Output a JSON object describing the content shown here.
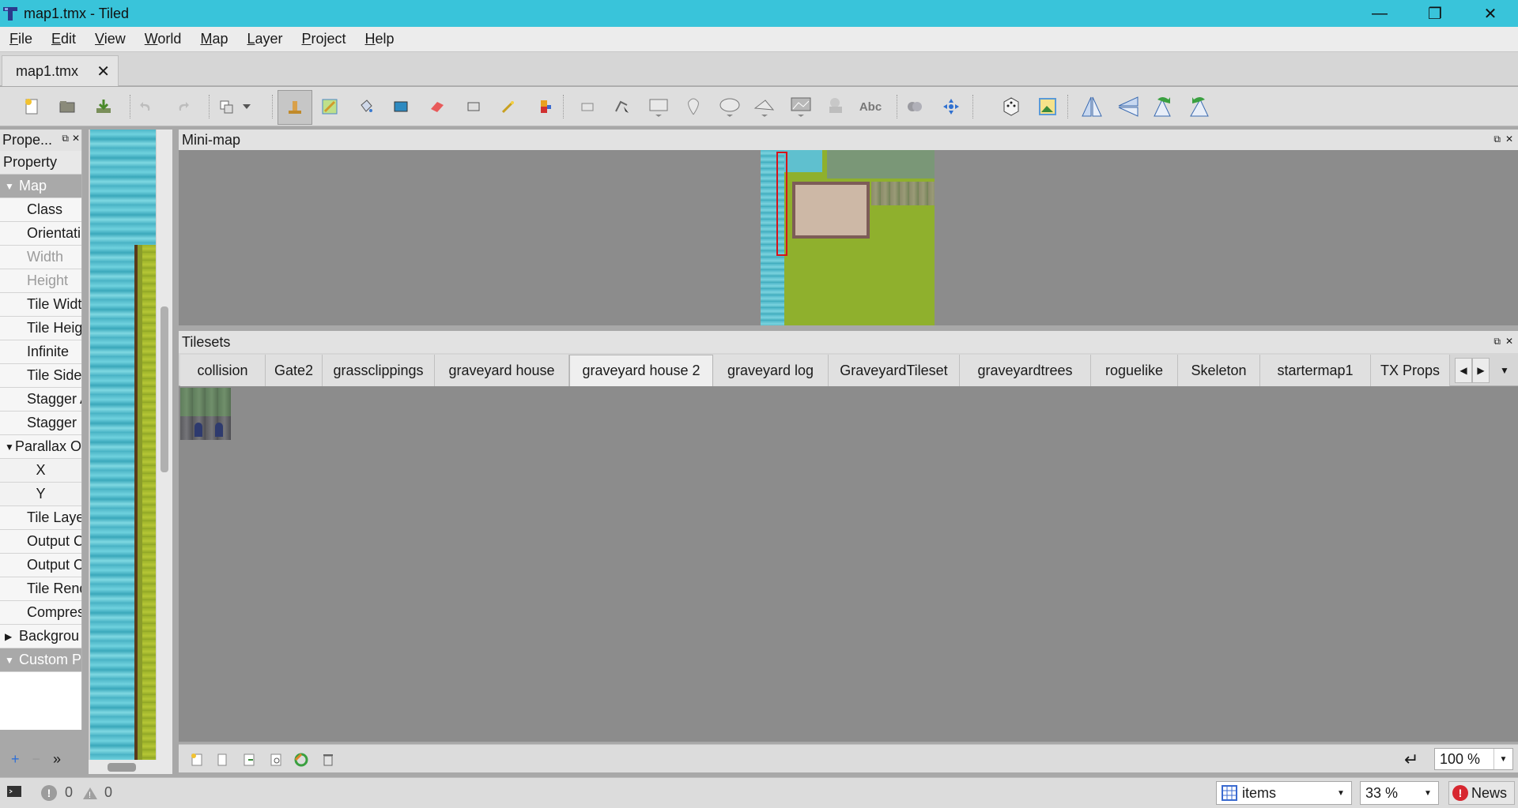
{
  "window": {
    "title": "map1.tmx - Tiled",
    "icon": "tiled-app-icon",
    "buttons": {
      "minimize": "—",
      "maximize": "❐",
      "close": "✕"
    }
  },
  "menubar": {
    "items": [
      "File",
      "Edit",
      "View",
      "World",
      "Map",
      "Layer",
      "Project",
      "Help"
    ]
  },
  "document_tabs": [
    {
      "label": "map1.tmx",
      "close": "✕",
      "active": true
    }
  ],
  "toolbar": {
    "icons": [
      "new-file-icon",
      "open-file-icon",
      "save-file-icon",
      "undo-icon",
      "redo-icon",
      "random-mode-icon",
      "stamp-brush-icon",
      "terrain-brush-icon",
      "bucket-fill-icon",
      "shape-fill-icon",
      "eraser-icon",
      "rectangle-select-icon",
      "magic-wand-icon",
      "select-same-tile-icon",
      "select-objects-icon",
      "edit-polygons-icon",
      "insert-rectangle-icon",
      "insert-point-icon",
      "insert-ellipse-icon",
      "insert-polygon-icon",
      "insert-tile-icon",
      "insert-template-icon",
      "insert-text-icon",
      "random-icon",
      "move-icon",
      "dice-icon",
      "stamp-icon",
      "flip-horizontal-icon",
      "flip-vertical-icon",
      "rotate-left-icon",
      "rotate-right-icon"
    ],
    "text_tool_label": "Abc"
  },
  "properties": {
    "title": "Prope...",
    "column_header": "Property",
    "rows": [
      {
        "label": "Map",
        "kind": "group"
      },
      {
        "label": "Class",
        "kind": "sub"
      },
      {
        "label": "Orientati",
        "kind": "sub"
      },
      {
        "label": "Width",
        "kind": "dim"
      },
      {
        "label": "Height",
        "kind": "dim"
      },
      {
        "label": "Tile Widt",
        "kind": "sub"
      },
      {
        "label": "Tile Heig",
        "kind": "sub"
      },
      {
        "label": "Infinite",
        "kind": "sub"
      },
      {
        "label": "Tile Side",
        "kind": "sub"
      },
      {
        "label": "Stagger A",
        "kind": "sub"
      },
      {
        "label": "Stagger I",
        "kind": "sub"
      },
      {
        "label": "Parallax O",
        "kind": "expanded"
      },
      {
        "label": "X",
        "kind": "center"
      },
      {
        "label": "Y",
        "kind": "center"
      },
      {
        "label": "Tile Layer",
        "kind": "sub"
      },
      {
        "label": "Output C",
        "kind": "sub"
      },
      {
        "label": "Output O",
        "kind": "sub"
      },
      {
        "label": "Tile Rend",
        "kind": "sub"
      },
      {
        "label": "Compres",
        "kind": "sub"
      },
      {
        "label": "Backgrou",
        "kind": "collapsed"
      },
      {
        "label": "Custom P",
        "kind": "group"
      }
    ],
    "actions": {
      "add": "+",
      "remove": "−",
      "more": "»"
    }
  },
  "minimap": {
    "title": "Mini-map"
  },
  "tilesets": {
    "title": "Tilesets",
    "tabs": [
      "collision",
      "Gate2",
      "grassclippings",
      "graveyard house",
      "graveyard house 2",
      "graveyard log",
      "GraveyardTileset",
      "graveyardtrees",
      "roguelike",
      "Skeleton",
      "startermap1",
      "TX Props"
    ],
    "active_tab": "graveyard house 2",
    "zoom": "100 %"
  },
  "statusbar": {
    "errors": "0",
    "warnings": "0",
    "layer_combo": "items",
    "zoom": "33 %",
    "news": "News",
    "news_badge": "!"
  }
}
